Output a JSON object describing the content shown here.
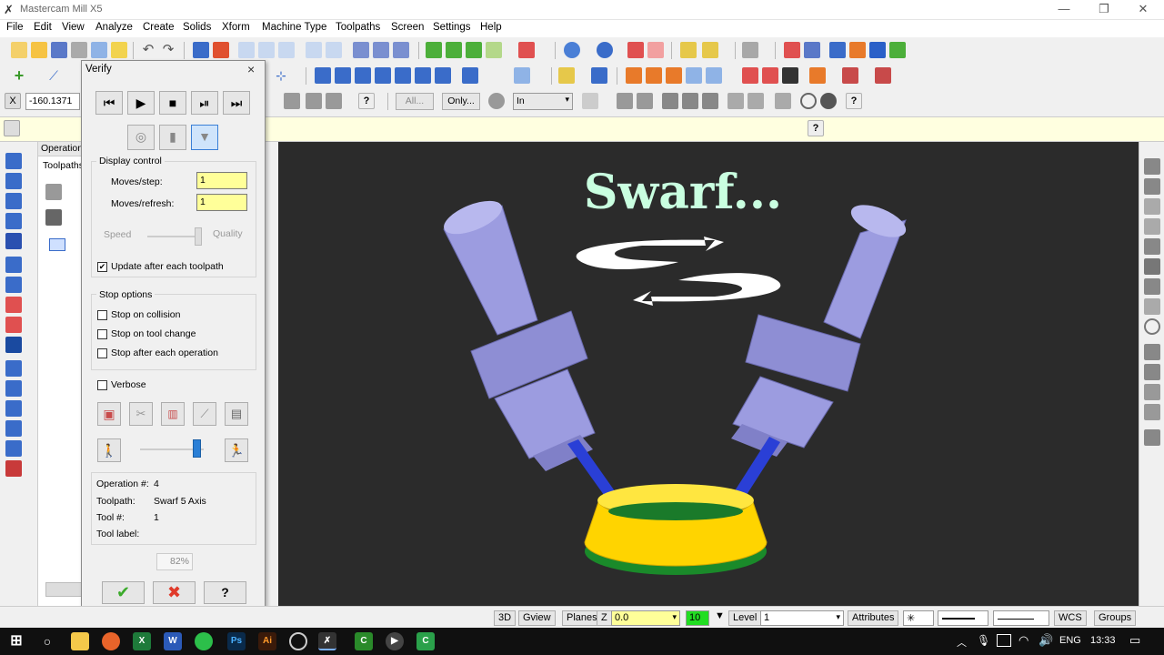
{
  "window": {
    "title": "Mastercam Mill X5",
    "minimize": "—",
    "restore": "❐",
    "close": "✕"
  },
  "menu": [
    "File",
    "Edit",
    "View",
    "Analyze",
    "Create",
    "Solids",
    "Xform",
    "Machine Type",
    "Toolpaths",
    "Screen",
    "Settings",
    "Help"
  ],
  "toolbar3": {
    "coord_value": "-160.1371",
    "all_label": "All...",
    "only_label": "Only...",
    "select_mode": "In"
  },
  "ribbon": {
    "help": "?"
  },
  "opmgr": {
    "tab_operations": "Operation",
    "tab_toolpaths": "Toolpaths"
  },
  "dialog": {
    "title": "Verify",
    "close": "×",
    "display_control": "Display control",
    "moves_step_label": "Moves/step:",
    "moves_step_value": "1",
    "moves_refresh_label": "Moves/refresh:",
    "moves_refresh_value": "1",
    "speed_label": "Speed",
    "quality_label": "Quality",
    "update_label": "Update after each toolpath",
    "update_checked": true,
    "stop_options": "Stop options",
    "stop_collision": "Stop on collision",
    "stop_tool_change": "Stop on tool change",
    "stop_each_op": "Stop after each operation",
    "verbose": "Verbose",
    "operation_label": "Operation #:",
    "operation_value": "4",
    "toolpath_label": "Toolpath:",
    "toolpath_value": "Swarf 5 Axis",
    "tool_label": "Tool #:",
    "tool_value": "1",
    "tool_label_label": "Tool label:",
    "tool_label_value": "",
    "progress": "82%",
    "ok": "✔",
    "cancel": "✖",
    "help": "?"
  },
  "viewport": {
    "overlay_title": "Swarf...",
    "background": "#2b2b2b",
    "holder_color": "#9c9ce0",
    "tool_color": "#2a3fd6",
    "part_color": "#ffd400",
    "part_edge_color": "#1a8a2a"
  },
  "statusbar": {
    "btn_3d": "3D",
    "gview": "Gview",
    "planes": "Planes",
    "z_label": "Z",
    "z_value": "0.0",
    "color_value": "10",
    "level_label": "Level",
    "level_value": "1",
    "attributes": "Attributes",
    "wcs": "WCS",
    "groups": "Groups"
  },
  "taskbar": {
    "language": "ENG",
    "time": "13:33"
  }
}
